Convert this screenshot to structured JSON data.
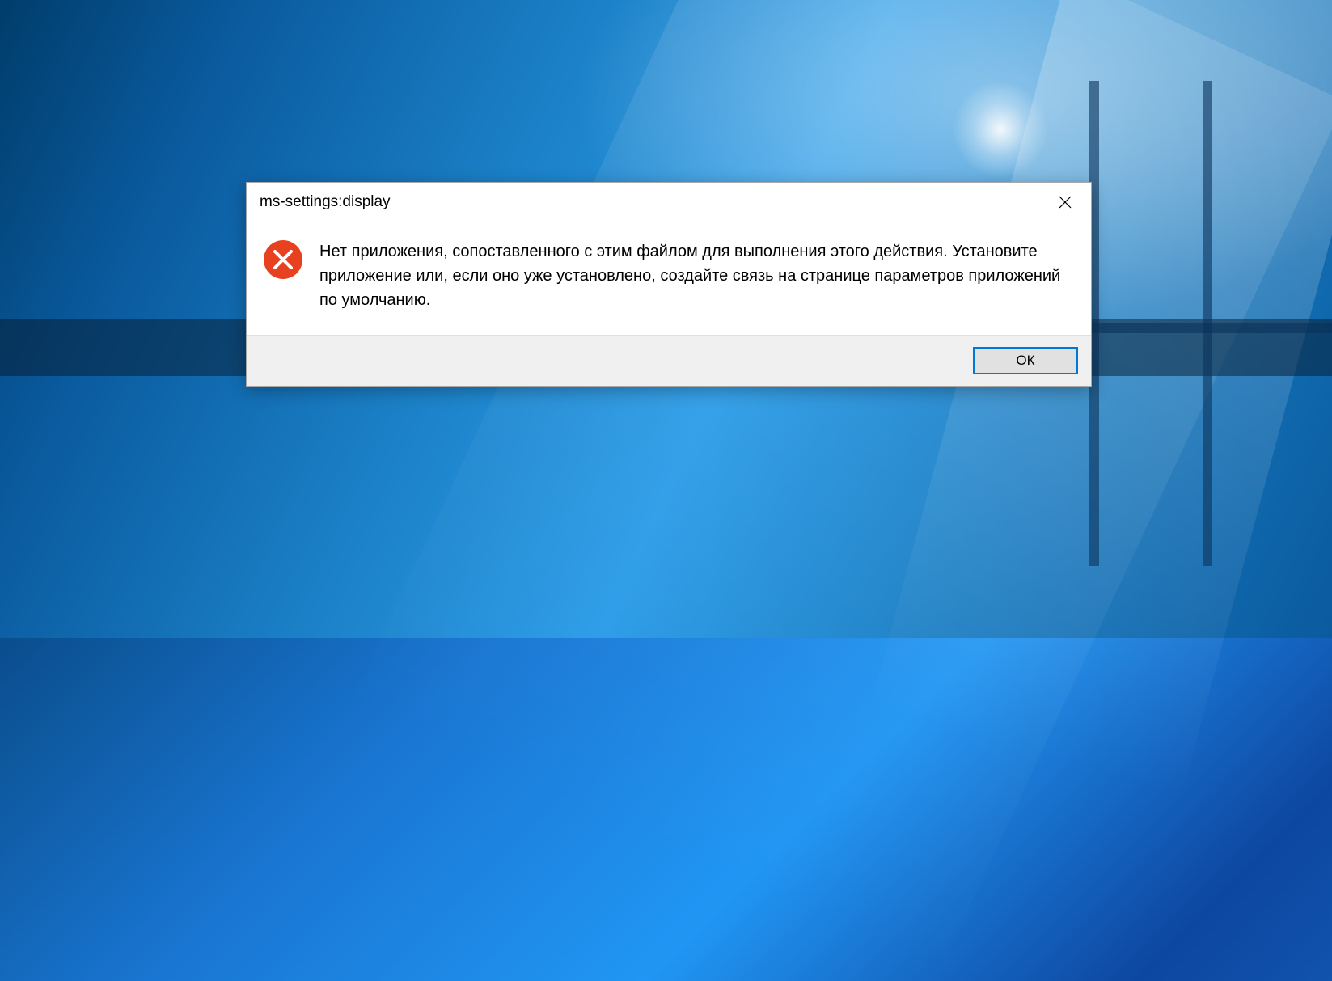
{
  "dialog": {
    "title": "ms-settings:display",
    "message": "Нет приложения, сопоставленного с этим файлом для выполнения этого действия. Установите приложение или, если оно уже установлено, создайте связь на странице параметров приложений по умолчанию.",
    "ok_label": "ОК",
    "icon": "error-x",
    "icon_color": "#e8411f"
  }
}
